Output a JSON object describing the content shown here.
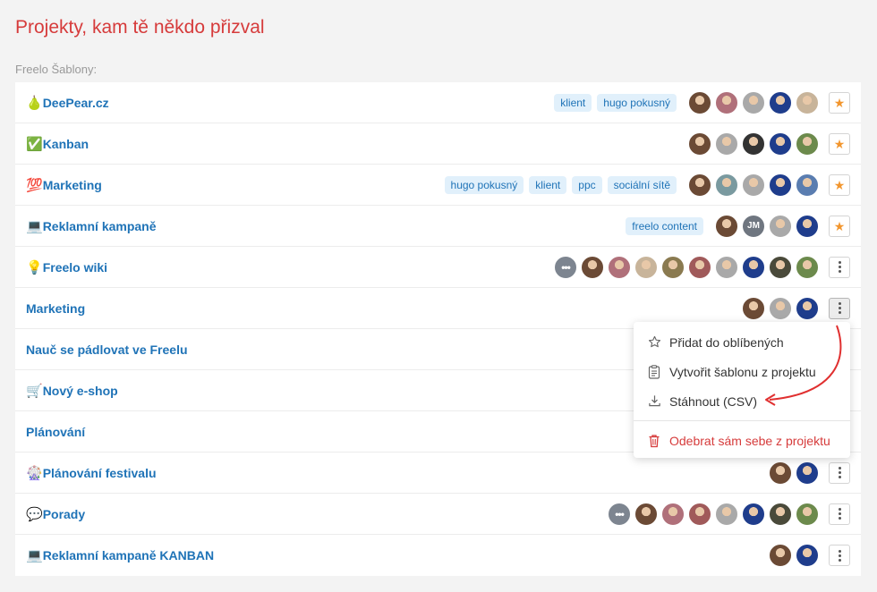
{
  "page": {
    "title": "Projekty, kam tě někdo přizval",
    "section_label": "Freelo Šablony:"
  },
  "colors": {
    "title": "#d63b3b",
    "link": "#1f73b7",
    "tag_bg": "#e1f0fb",
    "star": "#f2962e",
    "danger": "#d63b3b"
  },
  "projects": [
    {
      "emoji": "🍐",
      "name": "DeePear.cz",
      "tags": [
        "klient",
        "hugo pokusný"
      ],
      "avatars": [
        "#6b4a35",
        "#b0707a",
        "#a9a9a9",
        "#1f3d8c",
        "#c8b49a"
      ],
      "more": false,
      "action": "star"
    },
    {
      "emoji": "✅",
      "name": "Kanban",
      "tags": [],
      "avatars": [
        "#6b4a35",
        "#a9a9a9",
        "#333333",
        "#1f3d8c",
        "#6c8a4c"
      ],
      "more": false,
      "action": "star"
    },
    {
      "emoji": "💯",
      "name": "Marketing",
      "tags": [
        "hugo pokusný",
        "klient",
        "ppc",
        "sociální sítě"
      ],
      "avatars": [
        "#6b4a35",
        "#7a9aa0",
        "#a9a9a9",
        "#1f3d8c",
        "#5a7db0"
      ],
      "more": false,
      "action": "star"
    },
    {
      "emoji": "💻",
      "name": "Reklamní kampaně",
      "tags": [
        "freelo content"
      ],
      "avatars": [
        "#6b4a35",
        "JM",
        "#a9a9a9",
        "#1f3d8c"
      ],
      "more": false,
      "action": "star"
    },
    {
      "emoji": "💡",
      "name": "Freelo wiki",
      "tags": [],
      "avatars": [
        "#6b4a35",
        "#b0707a",
        "#c8b49a",
        "#8a7a50",
        "#a05a5a",
        "#a9a9a9",
        "#1f3d8c",
        "#4a4a3a",
        "#6c8a4c"
      ],
      "more": true,
      "action": "dots"
    },
    {
      "emoji": "",
      "name": "Marketing",
      "tags": [],
      "avatars": [
        "#6b4a35",
        "#a9a9a9",
        "#1f3d8c"
      ],
      "more": false,
      "action": "dots-active"
    },
    {
      "emoji": "",
      "name": "Nauč se pádlovat ve Freelu",
      "tags": [],
      "avatars": [],
      "more": false,
      "action": "none"
    },
    {
      "emoji": "🛒",
      "name": "Nový e-shop",
      "tags": [],
      "avatars": [],
      "more": false,
      "action": "none"
    },
    {
      "emoji": "",
      "name": "Plánování",
      "tags": [],
      "avatars": [],
      "more": false,
      "action": "none"
    },
    {
      "emoji": "🎡",
      "name": "Plánování festivalu",
      "tags": [],
      "avatars": [
        "#6b4a35",
        "#1f3d8c"
      ],
      "more": false,
      "action": "dots"
    },
    {
      "emoji": "💬",
      "name": "Porady",
      "tags": [],
      "avatars": [
        "#6b4a35",
        "#b0707a",
        "#a05a5a",
        "#a9a9a9",
        "#1f3d8c",
        "#4a4a3a",
        "#6c8a4c"
      ],
      "more": true,
      "action": "dots"
    },
    {
      "emoji": "💻",
      "name": "Reklamní kampaně KANBAN",
      "tags": [],
      "avatars": [
        "#6b4a35",
        "#1f3d8c"
      ],
      "more": false,
      "action": "dots"
    }
  ],
  "context_menu": {
    "items": [
      {
        "label": "Přidat do oblíbených",
        "icon": "star-outline-icon"
      },
      {
        "label": "Vytvořit šablonu z projektu",
        "icon": "clipboard-icon"
      },
      {
        "label": "Stáhnout (CSV)",
        "icon": "download-icon"
      }
    ],
    "danger_item": {
      "label": "Odebrat sám sebe z projektu",
      "icon": "trash-icon"
    }
  }
}
